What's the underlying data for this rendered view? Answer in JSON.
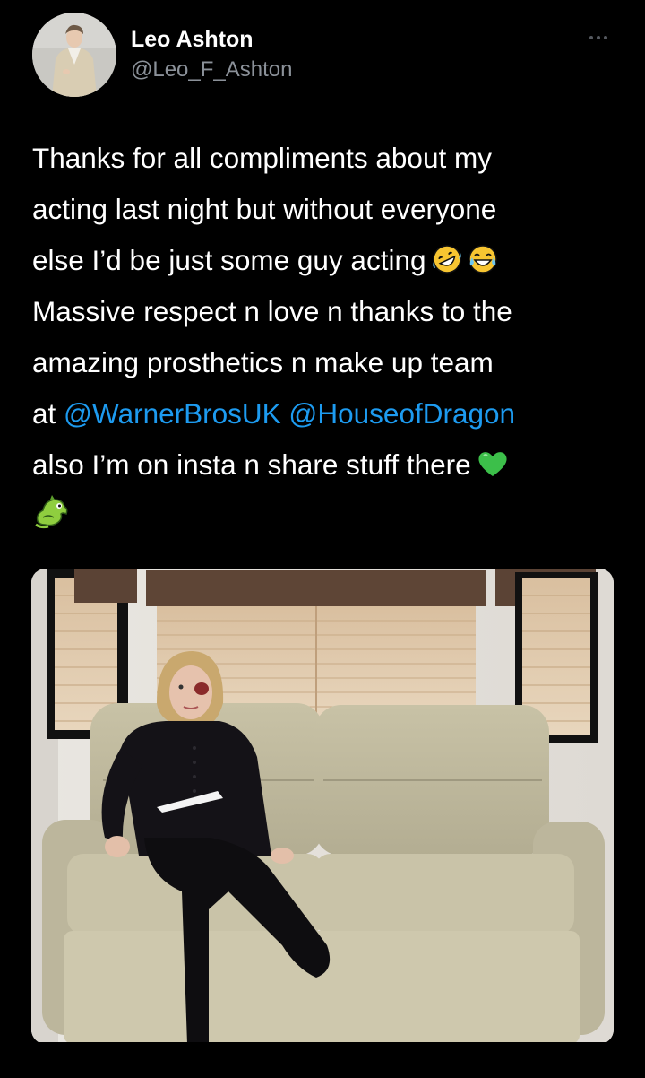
{
  "author": {
    "name": "Leo Ashton",
    "handle": "@Leo_F_Ashton"
  },
  "tweet": {
    "line1": "Thanks for all compliments about my",
    "line2": "acting last night but without everyone",
    "line3_text": "else I’d be just some guy acting",
    "line3_emojis": [
      "rolling-on-floor-laughing-emoji",
      "tears-of-joy-emoji"
    ],
    "line4": "Massive respect n love n thanks to the",
    "line5": "amazing prosthetics n make up team",
    "line6_prefix": "at",
    "mention1": "@WarnerBrosUK",
    "mention2": "@HouseofDragon",
    "line7_text": "also I’m on insta n share stuff there",
    "line7_emoji": "green-heart-emoji",
    "line8_emoji": "dragon-emoji"
  },
  "colors": {
    "background": "#000000",
    "text": "#ffffff",
    "handle": "#8b9199",
    "mention": "#1d9bf0",
    "green_heart": "#3cbf4a",
    "dragon": "#8fce3f",
    "emoji_yellow": "#f7c531"
  },
  "media": {
    "description_icon": "photo"
  }
}
